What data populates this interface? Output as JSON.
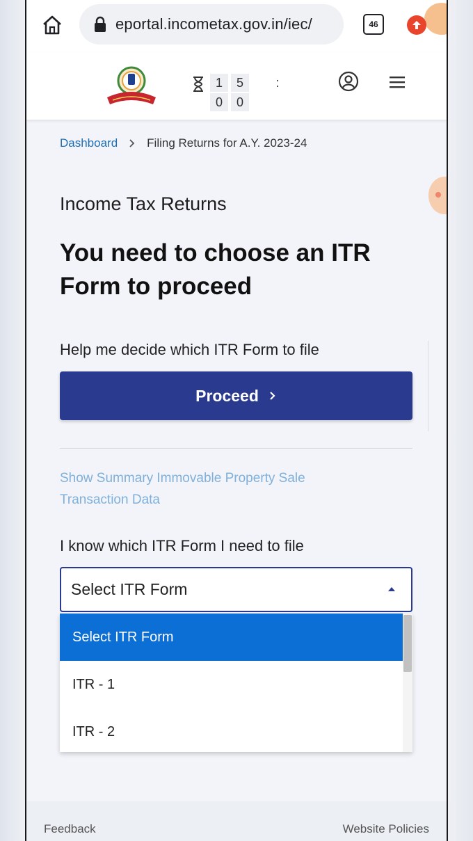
{
  "browser": {
    "url": "eportal.incometax.gov.in/iec/",
    "tab_count": "46"
  },
  "header": {
    "timer": {
      "digits_top": [
        "1",
        "5"
      ],
      "digits_bottom": [
        "0",
        "0"
      ],
      "separator": ":"
    }
  },
  "breadcrumb": {
    "home": "Dashboard",
    "current": "Filing Returns for A.Y. 2023-24"
  },
  "main": {
    "section_label": "Income Tax Returns",
    "heading": "You need to choose an ITR Form to proceed",
    "help_text": "Help me decide which ITR Form to file",
    "proceed_label": "Proceed",
    "summary_link": "Show Summary Immovable Property Sale Transaction Data",
    "know_text": "I know which ITR Form I need to file",
    "select": {
      "value": "Select ITR Form",
      "options": [
        "Select ITR Form",
        "ITR - 1",
        "ITR - 2"
      ]
    }
  },
  "footer": {
    "left": "Feedback",
    "right": "Website Policies"
  },
  "colors": {
    "primary_button": "#2a3a8f",
    "selected_option": "#0b6fd6",
    "link": "#1f6fb5",
    "disabled_link": "#7fb0db"
  }
}
